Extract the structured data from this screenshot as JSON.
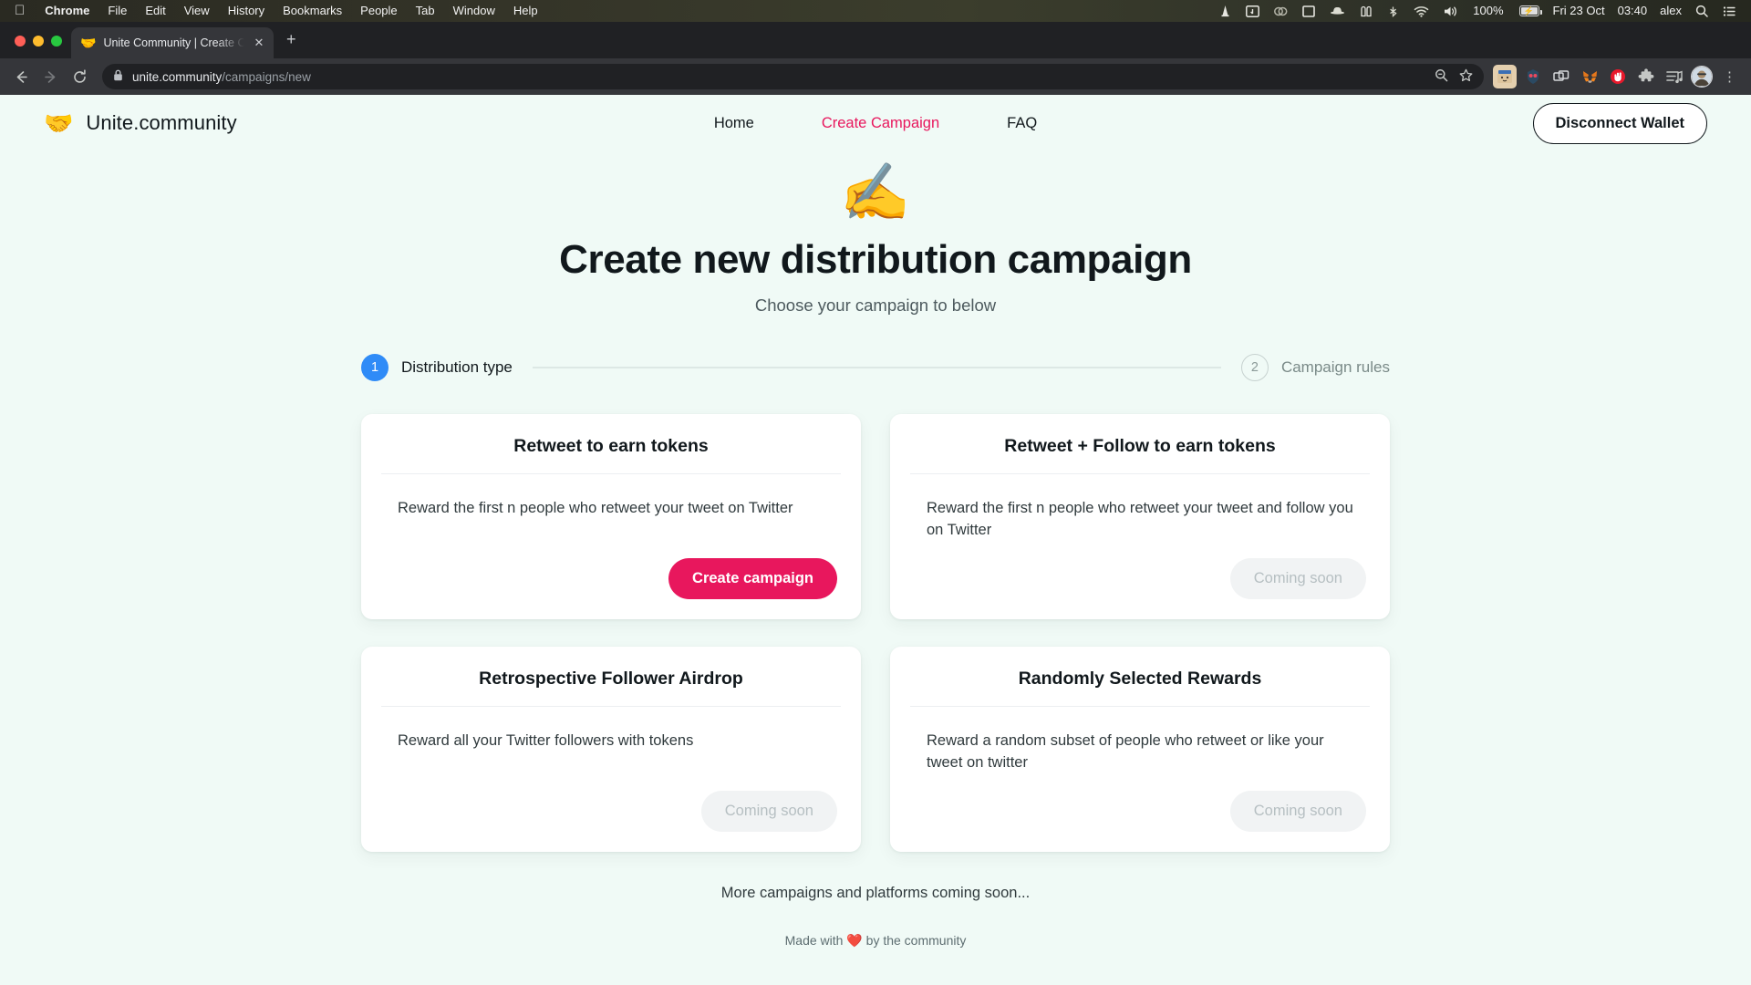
{
  "menubar": {
    "apple_icon": "apple-logo",
    "items": [
      "Chrome",
      "File",
      "Edit",
      "View",
      "History",
      "Bookmarks",
      "People",
      "Tab",
      "Window",
      "Help"
    ],
    "status_icons": [
      "vlc-cone-icon",
      "screen-mirroring-icon",
      "adobe-cc-icon",
      "display-icon",
      "incognito-hat-icon",
      "battery-stack-icon",
      "bluetooth-icon",
      "wifi-icon",
      "volume-icon"
    ],
    "battery_percent": "100%",
    "date": "Fri 23 Oct",
    "time": "03:40",
    "user": "alex",
    "search_icon": "search-icon",
    "control_center_icon": "control-center-icon"
  },
  "browser": {
    "tab": {
      "favicon": "🤝",
      "title": "Unite Community | Create Cam",
      "close_icon": "close-icon"
    },
    "new_tab_label": "+",
    "nav": {
      "back_icon": "back-arrow-icon",
      "forward_icon": "forward-arrow-icon",
      "reload_icon": "reload-icon"
    },
    "omnibox": {
      "lock_icon": "lock-icon",
      "url_domain": "unite.community",
      "url_path": "/campaigns/new",
      "zoom_icon": "zoom-search-icon",
      "bookmark_icon": "star-icon"
    },
    "extensions": [
      {
        "name": "extension-bitski",
        "glyph": "🗃"
      },
      {
        "name": "extension-wallet-guard",
        "glyph": "🥽"
      },
      {
        "name": "extension-tab-manager",
        "glyph": "🗂"
      },
      {
        "name": "extension-metamask",
        "glyph": "🦊"
      },
      {
        "name": "extension-blocker",
        "glyph": "🛑"
      },
      {
        "name": "extensions-puzzle",
        "glyph": "🧩"
      },
      {
        "name": "reading-list",
        "glyph": "☰"
      }
    ],
    "profile_avatar": "👤",
    "menu_icon": "kebab-menu-icon"
  },
  "site": {
    "brand": {
      "emoji": "🤝",
      "name": "Unite.community"
    },
    "nav": [
      {
        "label": "Home",
        "active": false
      },
      {
        "label": "Create Campaign",
        "active": true
      },
      {
        "label": "FAQ",
        "active": false
      }
    ],
    "wallet_button": "Disconnect Wallet",
    "accent_color": "#e8175d",
    "step_active_color": "#2f8bf7",
    "background_color": "#f0faf6"
  },
  "hero": {
    "emoji": "✍️",
    "title": "Create new distribution campaign",
    "subtitle": "Choose your campaign to below"
  },
  "stepper": {
    "steps": [
      {
        "number": "1",
        "label": "Distribution type",
        "state": "active"
      },
      {
        "number": "2",
        "label": "Campaign rules",
        "state": "idle"
      }
    ]
  },
  "cards": [
    {
      "title": "Retweet to earn tokens",
      "description": "Reward the first n people who retweet your tweet on Twitter",
      "button": {
        "label": "Create campaign",
        "enabled": true
      }
    },
    {
      "title": "Retweet + Follow to earn tokens",
      "description": "Reward the first n people who retweet your tweet and follow you on Twitter",
      "button": {
        "label": "Coming soon",
        "enabled": false
      }
    },
    {
      "title": "Retrospective Follower Airdrop",
      "description": "Reward all your Twitter followers with tokens",
      "button": {
        "label": "Coming soon",
        "enabled": false
      }
    },
    {
      "title": "Randomly Selected Rewards",
      "description": "Reward a random subset of people who retweet or like your tweet on twitter",
      "button": {
        "label": "Coming soon",
        "enabled": false
      }
    }
  ],
  "footer": {
    "more_note": "More campaigns and platforms coming soon...",
    "tagline_prefix": "Made with",
    "tagline_heart": "❤️",
    "tagline_suffix": "by the community"
  }
}
